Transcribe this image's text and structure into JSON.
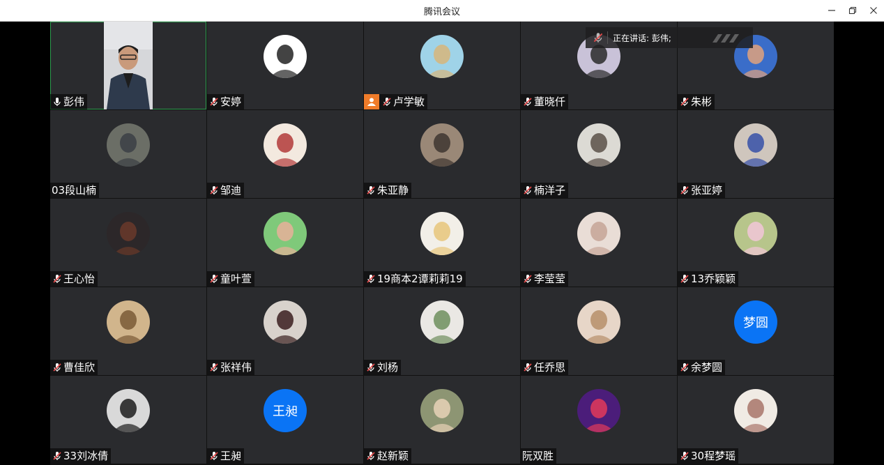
{
  "window": {
    "title": "腾讯会议",
    "minimize_icon": "minimize-icon",
    "restore_icon": "restore-icon",
    "close_icon": "close-icon"
  },
  "speaking": {
    "label": "正在讲话: 彭伟;",
    "icon": "mic-muted-icon"
  },
  "colors": {
    "tile_bg": "#2a2b2e",
    "active_border": "#2e9e4f",
    "letter_avatar": "#0a74f5",
    "host_badge": "#f07c2a"
  },
  "participants": [
    {
      "name": "彭伟",
      "mic": "on",
      "video": true
    },
    {
      "name": "安婷",
      "mic": "muted"
    },
    {
      "name": "卢学敏",
      "mic": "muted",
      "host": true
    },
    {
      "name": "董晓仟",
      "mic": "muted"
    },
    {
      "name": "朱彬",
      "mic": "muted"
    },
    {
      "name": "03段山楠",
      "mic": "none"
    },
    {
      "name": "邹迪",
      "mic": "muted"
    },
    {
      "name": "朱亚静",
      "mic": "muted"
    },
    {
      "name": "楠洋子",
      "mic": "muted"
    },
    {
      "name": "张亚婷",
      "mic": "muted"
    },
    {
      "name": "王心怡",
      "mic": "muted"
    },
    {
      "name": "童叶萱",
      "mic": "muted"
    },
    {
      "name": "19商本2谭莉莉19",
      "mic": "muted"
    },
    {
      "name": "李莹莹",
      "mic": "muted"
    },
    {
      "name": "13乔颖颖",
      "mic": "muted"
    },
    {
      "name": "曹佳欣",
      "mic": "muted"
    },
    {
      "name": "张祥伟",
      "mic": "muted"
    },
    {
      "name": "刘杨",
      "mic": "muted"
    },
    {
      "name": "任乔思",
      "mic": "muted"
    },
    {
      "name": "余梦圆",
      "mic": "muted",
      "avatar_text": "梦圆"
    },
    {
      "name": "33刘冰倩",
      "mic": "muted"
    },
    {
      "name": "王昶",
      "mic": "muted",
      "avatar_text": "王昶"
    },
    {
      "name": "赵新颖",
      "mic": "muted"
    },
    {
      "name": "阮双胜",
      "mic": "none"
    },
    {
      "name": "30程梦瑶",
      "mic": "muted"
    }
  ]
}
